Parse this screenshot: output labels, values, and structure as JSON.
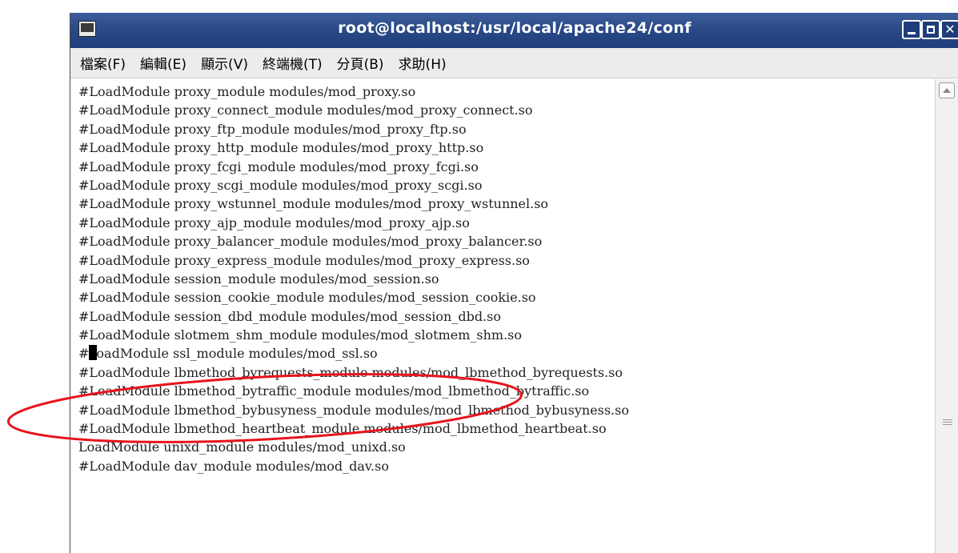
{
  "window": {
    "title": "root@localhost:/usr/local/apache24/conf"
  },
  "menu": {
    "items": [
      "檔案(F)",
      "編輯(E)",
      "顯示(V)",
      "終端機(T)",
      "分頁(B)",
      "求助(H)"
    ]
  },
  "terminal": {
    "lines": [
      "#LoadModule proxy_module modules/mod_proxy.so",
      "#LoadModule proxy_connect_module modules/mod_proxy_connect.so",
      "#LoadModule proxy_ftp_module modules/mod_proxy_ftp.so",
      "#LoadModule proxy_http_module modules/mod_proxy_http.so",
      "#LoadModule proxy_fcgi_module modules/mod_proxy_fcgi.so",
      "#LoadModule proxy_scgi_module modules/mod_proxy_scgi.so",
      "#LoadModule proxy_wstunnel_module modules/mod_proxy_wstunnel.so",
      "#LoadModule proxy_ajp_module modules/mod_proxy_ajp.so",
      "#LoadModule proxy_balancer_module modules/mod_proxy_balancer.so",
      "#LoadModule proxy_express_module modules/mod_proxy_express.so",
      "#LoadModule session_module modules/mod_session.so",
      "#LoadModule session_cookie_module modules/mod_session_cookie.so",
      "#LoadModule session_dbd_module modules/mod_session_dbd.so",
      "#LoadModule slotmem_shm_module modules/mod_slotmem_shm.so",
      "#LoadModule ssl_module modules/mod_ssl.so",
      "#LoadModule lbmethod_byrequests_module modules/mod_lbmethod_byrequests.so",
      "#LoadModule lbmethod_bytraffic_module modules/mod_lbmethod_bytraffic.so",
      "#LoadModule lbmethod_bybusyness_module modules/mod_lbmethod_bybusyness.so",
      "#LoadModule lbmethod_heartbeat_module modules/mod_lbmethod_heartbeat.so",
      "LoadModule unixd_module modules/mod_unixd.so",
      "#LoadModule dav_module modules/mod_dav.so"
    ],
    "cursor_line": 14,
    "cursor_char": 1
  },
  "annotation": {
    "color": "#e8141c"
  }
}
